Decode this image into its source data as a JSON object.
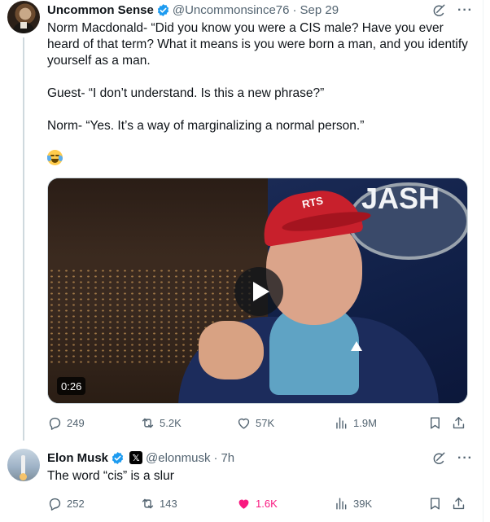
{
  "tweet1": {
    "author_name": "Uncommon Sense",
    "handle": "@Uncommonsince76",
    "separator": "·",
    "date": "Sep 29",
    "text_line1": "Norm Macdonald- “Did you know you were a CIS male? Have you ever",
    "text_line2": "heard of that term? What it means is you were born a man, and you identify",
    "text_line3": "yourself as a man.",
    "text_guest": "Guest- “I don’t understand. Is this a new phrase?”",
    "text_norm": "Norm- “Yes. It’s a way of marginalizing a normal person.”",
    "emoji": "face-with-tears-of-joy",
    "video": {
      "duration": "0:26",
      "sign_text": "JASH",
      "cap_text": "RTS"
    },
    "replies": "249",
    "retweets": "5.2K",
    "likes": "57K",
    "views": "1.9M"
  },
  "tweet2": {
    "author_name": "Elon Musk",
    "affiliate_badge": "𝕏",
    "handle": "@elonmusk",
    "separator": "·",
    "date": "7h",
    "text": "The word “cis” is a slur",
    "replies": "252",
    "retweets": "143",
    "likes": "1.6K",
    "views": "39K",
    "liked": true
  },
  "colors": {
    "text_primary": "#0f1419",
    "text_secondary": "#536471",
    "verified_blue": "#1d9bf0",
    "like_pink": "#f91880",
    "thread_line": "#cfd9de"
  }
}
